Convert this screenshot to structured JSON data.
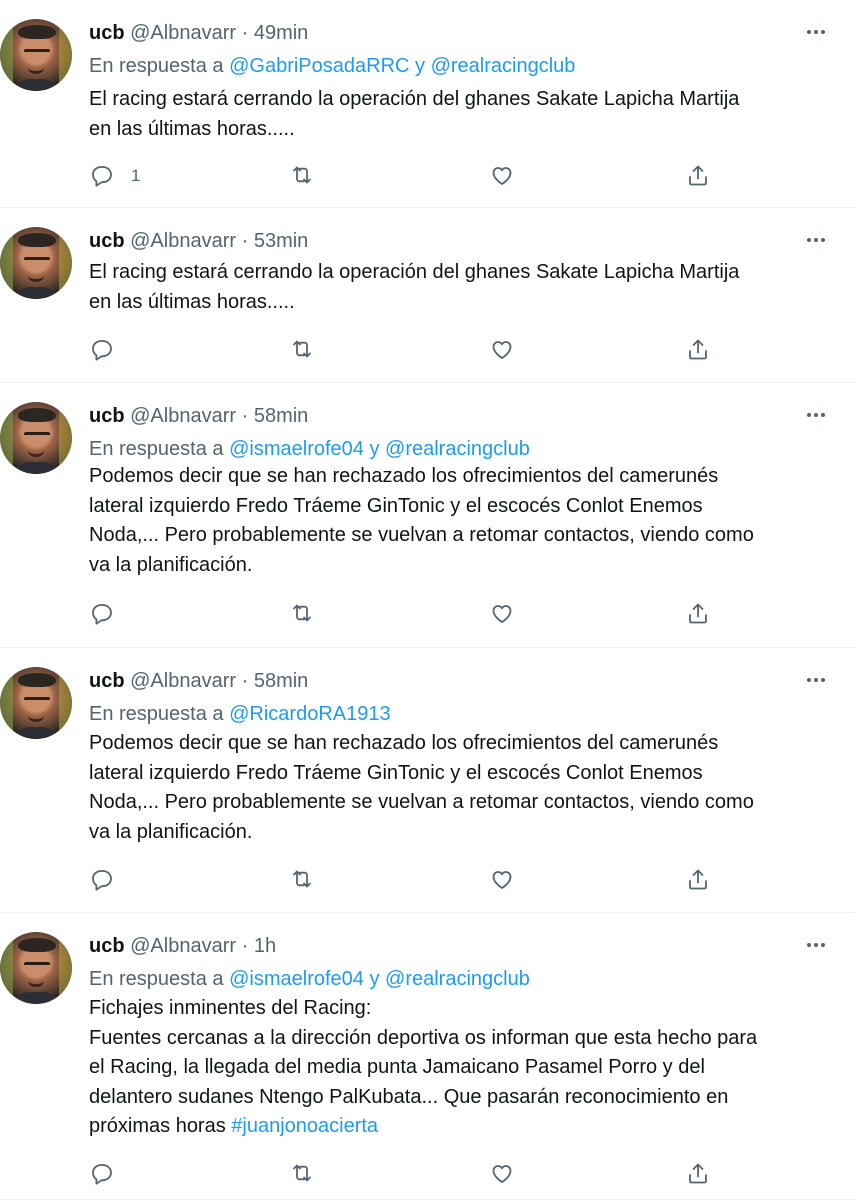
{
  "tweets": [
    {
      "name": "ucb",
      "handle": "@Albnavarr",
      "separator": "·",
      "time": "49min",
      "reply": {
        "prefix": "En respuesta a",
        "users": [
          "@GabriPosadaRRC",
          "@realracingclub"
        ],
        "joiner": "y"
      },
      "text": "El racing estará cerrando la operación del ghanes Sakate Lapicha Martija\nen las últimas horas.....",
      "hashtag": "",
      "reply_count": "1"
    },
    {
      "name": "ucb",
      "handle": "@Albnavarr",
      "separator": "·",
      "time": "53min",
      "reply": null,
      "text": "El racing estará cerrando la operación del ghanes Sakate Lapicha Martija\nen las últimas horas.....",
      "hashtag": "",
      "reply_count": ""
    },
    {
      "name": "ucb",
      "handle": "@Albnavarr",
      "separator": "·",
      "time": "58min",
      "reply": {
        "prefix": "En respuesta a",
        "users": [
          "@ismaelrofe04",
          "@realracingclub"
        ],
        "joiner": "y"
      },
      "text": "Podemos decir que se han rechazado los ofrecimientos del camerunés\nlateral izquierdo Fredo Tráeme GinTonic y el escocés Conlot Enemos\nNoda,... Pero probablemente se vuelvan a retomar contactos,  viendo como\nva la planificación.",
      "hashtag": "",
      "reply_count": ""
    },
    {
      "name": "ucb",
      "handle": "@Albnavarr",
      "separator": "·",
      "time": "58min",
      "reply": {
        "prefix": "En respuesta a",
        "users": [
          "@RicardoRA1913"
        ],
        "joiner": ""
      },
      "text": "Podemos decir que se han rechazado los ofrecimientos del camerunés\nlateral izquierdo Fredo Tráeme GinTonic y el escocés Conlot Enemos\nNoda,... Pero probablemente se vuelvan a retomar contactos,  viendo como\nva la planificación.",
      "hashtag": "",
      "reply_count": ""
    },
    {
      "name": "ucb",
      "handle": "@Albnavarr",
      "separator": "·",
      "time": "1h",
      "reply": {
        "prefix": "En respuesta a",
        "users": [
          "@ismaelrofe04",
          "@realracingclub"
        ],
        "joiner": "y"
      },
      "text": "Fichajes inminentes del Racing:\nFuentes cercanas a la dirección deportiva os informan que esta hecho para\nel Racing,  la llegada del media punta Jamaicano Pasamel Porro y del\ndelantero sudanes Ntengo PalKubata... Que pasarán reconocimiento en\npróximas horas ",
      "hashtag": "#juanjonoacierta",
      "reply_count": ""
    }
  ],
  "icons": {
    "more": "more-horizontal-icon",
    "reply": "reply-icon",
    "retweet": "retweet-icon",
    "like": "like-icon",
    "share": "share-icon"
  },
  "colors": {
    "text": "#0f1419",
    "secondary": "#536471",
    "link": "#1d9bf0",
    "border": "#eff3f4"
  }
}
